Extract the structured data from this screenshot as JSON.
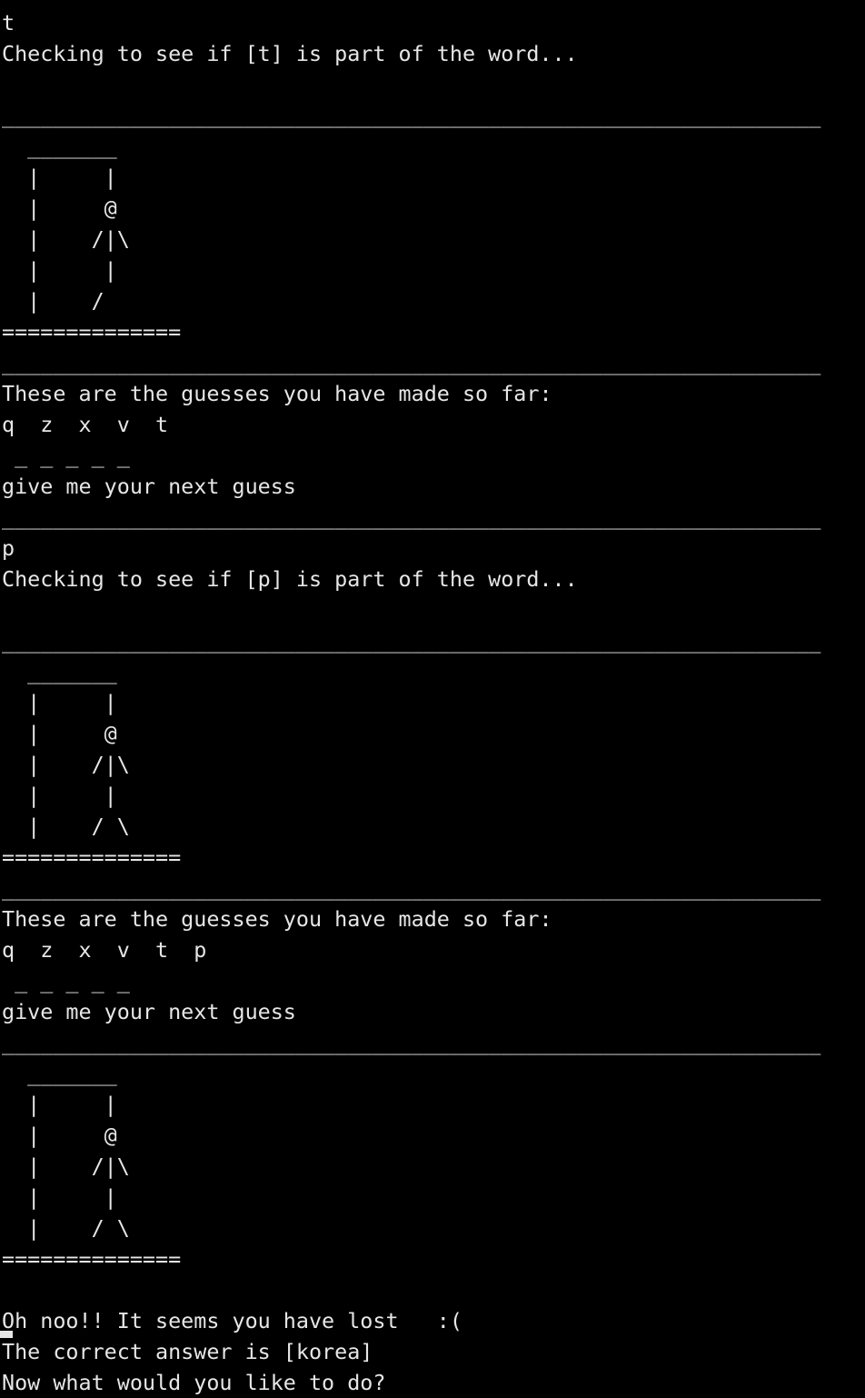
{
  "terminal": {
    "lines": [
      "t",
      "Checking to see if [t] is part of the word...",
      "",
      "________________________________________________________________",
      "  _______",
      "  |     |",
      "  |     @",
      "  |    /|\\",
      "  |     |",
      "  |    /",
      "==============",
      "________________________________________________________________",
      "These are the guesses you have made so far:",
      "q  z  x  v  t",
      " _ _ _ _ _",
      "give me your next guess",
      "________________________________________________________________",
      "p",
      "Checking to see if [p] is part of the word...",
      "",
      "________________________________________________________________",
      "  _______",
      "  |     |",
      "  |     @",
      "  |    /|\\",
      "  |     |",
      "  |    / \\",
      "==============",
      "________________________________________________________________",
      "These are the guesses you have made so far:",
      "q  z  x  v  t  p",
      " _ _ _ _ _",
      "give me your next guess",
      "________________________________________________________________",
      "  _______",
      "  |     |",
      "  |     @",
      "  |    /|\\",
      "  |     |",
      "  |    / \\",
      "==============",
      "",
      "Oh noo!! It seems you have lost   :(",
      "The correct answer is [korea]",
      "Now what would you like to do?"
    ]
  },
  "colors": {
    "background": "#000000",
    "foreground": "#e6e6e6"
  }
}
